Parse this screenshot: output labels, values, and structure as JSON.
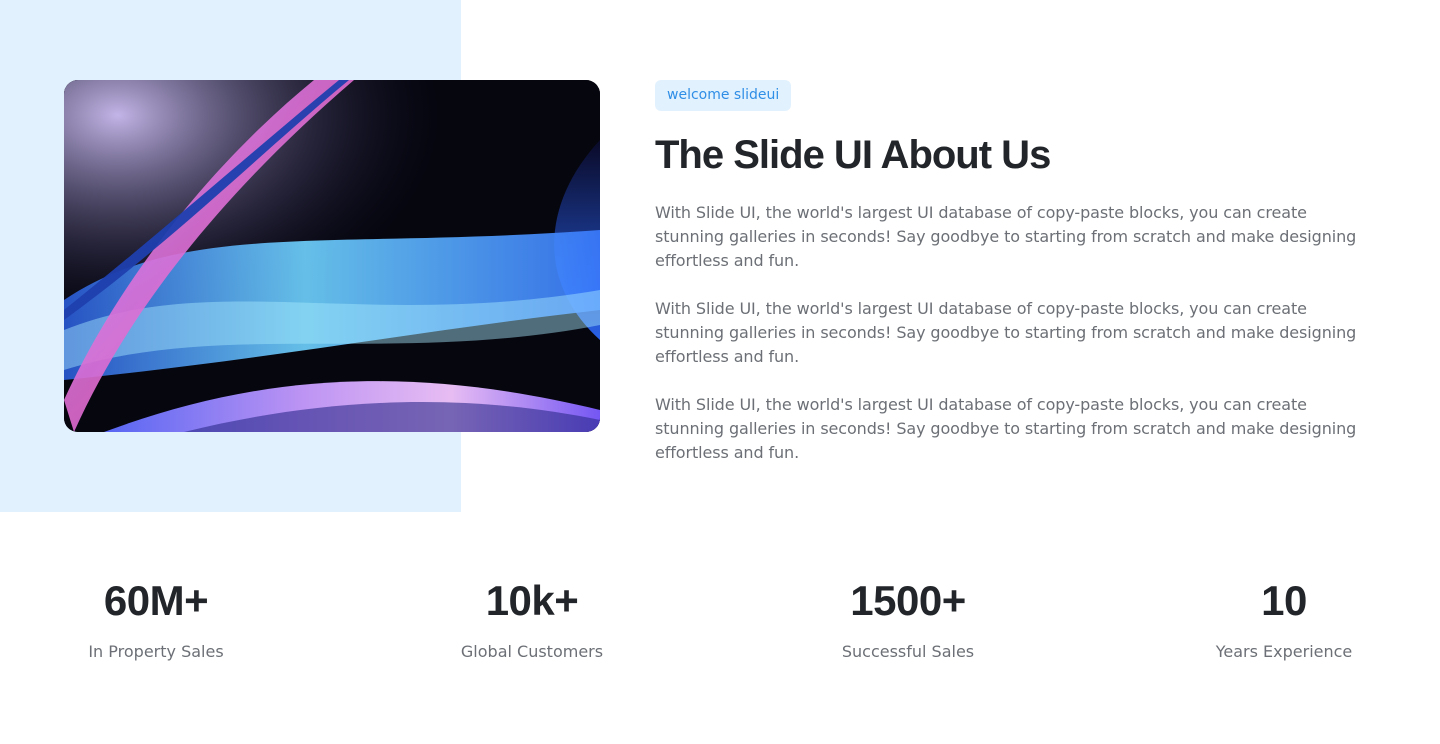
{
  "about": {
    "badge": "welcome slideui",
    "title": "The Slide UI About Us",
    "paragraphs": [
      "With Slide UI, the world's largest UI database of copy-paste blocks, you can create stunning galleries in seconds! Say goodbye to starting from scratch and make designing effortless and fun.",
      "With Slide UI, the world's largest UI database of copy-paste blocks, you can create stunning galleries in seconds! Say goodbye to starting from scratch and make designing effortless and fun.",
      "With Slide UI, the world's largest UI database of copy-paste blocks, you can create stunning galleries in seconds! Say goodbye to starting from scratch and make designing effortless and fun."
    ]
  },
  "stats": [
    {
      "value": "60M+",
      "label": "In Property Sales"
    },
    {
      "value": "10k+",
      "label": "Global Customers"
    },
    {
      "value": "1500+",
      "label": "Successful Sales"
    },
    {
      "value": "10",
      "label": "Years Experience"
    }
  ],
  "colors": {
    "panel_bg": "#e2f1fe",
    "accent": "#2f8ee6",
    "heading": "#222529",
    "body_text": "#6c7076"
  }
}
